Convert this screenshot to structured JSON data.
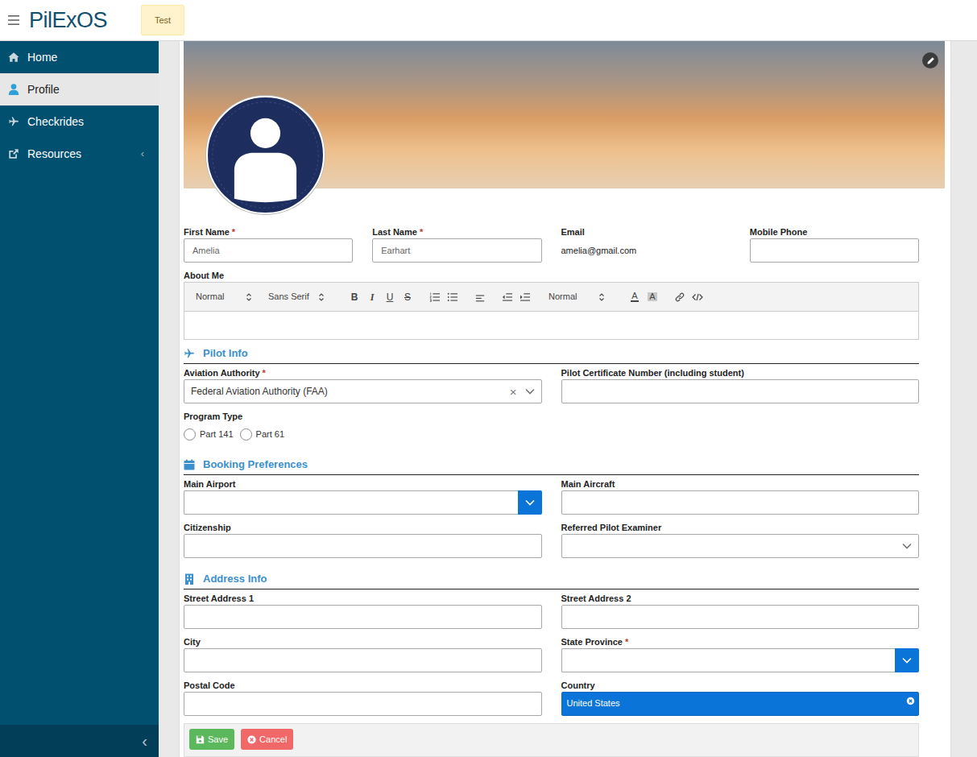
{
  "header": {
    "logo": "PilExOS",
    "badge": "Test"
  },
  "sidebar": {
    "items": [
      {
        "label": "Home",
        "kind": "home",
        "selected": false
      },
      {
        "label": "Profile",
        "kind": "user",
        "selected": true
      },
      {
        "label": "Checkrides",
        "kind": "plane",
        "selected": false
      },
      {
        "label": "Resources",
        "kind": "external",
        "selected": false,
        "chevron": "‹"
      }
    ],
    "collapse": "‹"
  },
  "form": {
    "required_mark": "*",
    "profile": [
      {
        "label": "First Name",
        "required": true,
        "kind": "input",
        "value": "Amelia"
      },
      {
        "label": "Last Name",
        "required": true,
        "kind": "input",
        "value": "Earhart"
      },
      {
        "label": "Email",
        "required": false,
        "kind": "static",
        "value": "amelia@gmail.com"
      },
      {
        "label": "Mobile Phone",
        "required": false,
        "kind": "input",
        "value": ""
      }
    ],
    "about": {
      "label": "About Me",
      "value": "",
      "toolbar": [
        {
          "kind": "picker",
          "label": "Normal"
        },
        {
          "kind": "picker",
          "label": "Sans Serif"
        },
        {
          "kind": "bold",
          "label": "B"
        },
        {
          "kind": "italic",
          "label": "I"
        },
        {
          "kind": "underline",
          "label": "U"
        },
        {
          "kind": "strike",
          "label": "S"
        },
        {
          "kind": "ordered-list"
        },
        {
          "kind": "bullet-list"
        },
        {
          "kind": "align"
        },
        {
          "kind": "outdent"
        },
        {
          "kind": "indent"
        },
        {
          "kind": "picker",
          "label": "Normal"
        },
        {
          "kind": "color",
          "label": "A"
        },
        {
          "kind": "background",
          "label": "A"
        },
        {
          "kind": "link"
        },
        {
          "kind": "code"
        }
      ]
    },
    "sections": [
      {
        "title": "Pilot Info",
        "kind": "plane",
        "rows": [
          [
            {
              "label": "Aviation Authority",
              "required": true,
              "kind": "select",
              "value": "Federal Aviation Authority (FAA)",
              "clear": "×"
            },
            {
              "label": "Pilot Certificate Number (including student)",
              "required": false,
              "kind": "input",
              "value": ""
            }
          ],
          [
            {
              "label": "Program Type",
              "required": false,
              "kind": "radio",
              "options": [
                {
                  "label": "Part 141",
                  "selected": false
                },
                {
                  "label": "Part 61",
                  "selected": false
                }
              ]
            }
          ]
        ]
      },
      {
        "title": "Booking Preferences",
        "kind": "calendar",
        "rows": [
          [
            {
              "label": "Main Airport",
              "required": false,
              "kind": "combo",
              "value": ""
            },
            {
              "label": "Main Aircraft",
              "required": false,
              "kind": "input",
              "value": ""
            }
          ],
          [
            {
              "label": "Citizenship",
              "required": false,
              "kind": "input",
              "value": ""
            },
            {
              "label": "Referred Pilot Examiner",
              "required": false,
              "kind": "select",
              "value": ""
            }
          ]
        ]
      },
      {
        "title": "Address Info",
        "kind": "building",
        "rows": [
          [
            {
              "label": "Street Address 1",
              "required": false,
              "kind": "input",
              "value": ""
            },
            {
              "label": "Street Address 2",
              "required": false,
              "kind": "input",
              "value": ""
            }
          ],
          [
            {
              "label": "City",
              "required": false,
              "kind": "input",
              "value": ""
            },
            {
              "label": "State Province",
              "required": true,
              "kind": "combo",
              "value": ""
            }
          ],
          [
            {
              "label": "Postal Code",
              "required": false,
              "kind": "input",
              "value": ""
            },
            {
              "label": "Country",
              "required": false,
              "kind": "chip",
              "value": "United States"
            }
          ]
        ]
      }
    ],
    "buttons": [
      {
        "label": "Save",
        "kind": "save"
      },
      {
        "label": "Cancel",
        "kind": "cancel"
      }
    ]
  }
}
